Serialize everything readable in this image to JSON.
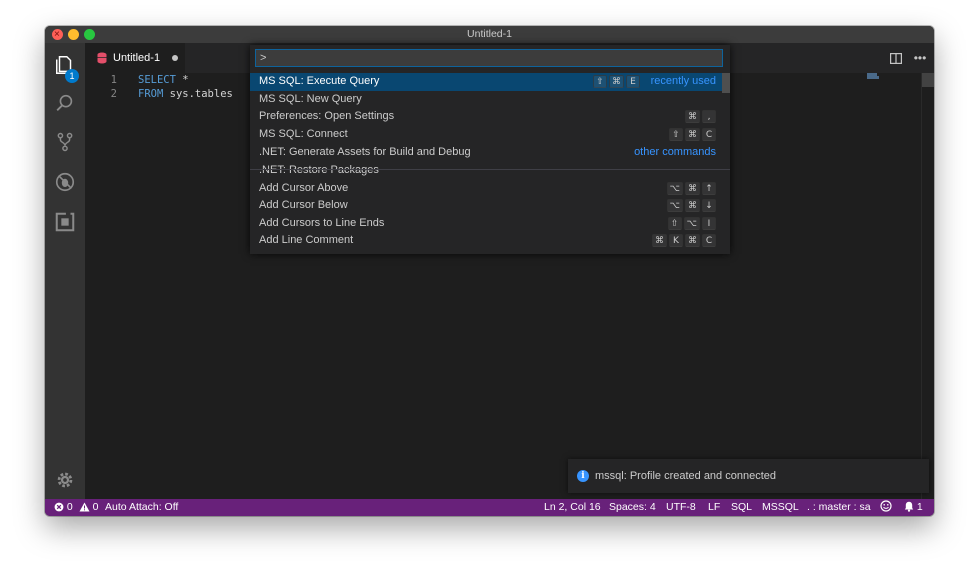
{
  "window": {
    "title": "Untitled-1"
  },
  "activity_bar": {
    "items": [
      "explorer-icon",
      "search-icon",
      "source-control-icon",
      "debug-icon",
      "extensions-icon"
    ],
    "explorer_badge": "1",
    "settings": "gear-icon"
  },
  "tab": {
    "label": "Untitled-1"
  },
  "editor": {
    "lines": [
      {
        "num": "1",
        "keyword": "SELECT",
        "rest": " *"
      },
      {
        "num": "2",
        "keyword": "FROM",
        "rest": " sys.tables"
      }
    ]
  },
  "palette": {
    "input_value": ">",
    "commands": [
      {
        "label": "MS SQL: Execute Query",
        "keys": [
          "⇧",
          "⌘",
          "E"
        ],
        "meta": "recently used",
        "selected": true
      },
      {
        "label": "MS SQL: New Query",
        "keys": [],
        "meta": ""
      },
      {
        "label": "Preferences: Open Settings",
        "keys": [
          "⌘",
          ","
        ],
        "meta": ""
      },
      {
        "label": "MS SQL: Connect",
        "keys": [
          "⇧",
          "⌘",
          "C"
        ],
        "meta": ""
      },
      {
        "label": ".NET: Generate Assets for Build and Debug",
        "keys": [],
        "meta": "other commands"
      },
      {
        "label": ".NET: Restore Packages",
        "keys": [],
        "meta": ""
      },
      {
        "label": "Add Cursor Above",
        "keys": [
          "⌥",
          "⌘",
          "↑"
        ],
        "meta": ""
      },
      {
        "label": "Add Cursor Below",
        "keys": [
          "⌥",
          "⌘",
          "↓"
        ],
        "meta": ""
      },
      {
        "label": "Add Cursors to Line Ends",
        "keys": [
          "⇧",
          "⌥",
          "I"
        ],
        "meta": ""
      },
      {
        "label": "Add Line Comment",
        "keys": [
          "⌘",
          "K",
          "⌘",
          "C"
        ],
        "meta": ""
      }
    ]
  },
  "notification": {
    "text": "mssql: Profile created and connected"
  },
  "status_bar": {
    "errors": "0",
    "warnings": "0",
    "auto_attach": "Auto Attach: Off",
    "position": "Ln 2, Col 16",
    "spaces": "Spaces: 4",
    "encoding": "UTF-8",
    "eol": "LF",
    "language": "SQL",
    "mssql": "MSSQL",
    "connection": ". : master : sa",
    "notifications": "1"
  },
  "colors": {
    "status_bar": "#68217a",
    "selection": "#094771",
    "accent": "#3794ff"
  }
}
